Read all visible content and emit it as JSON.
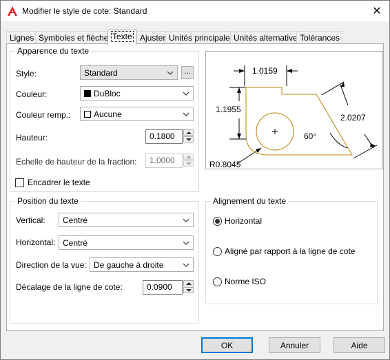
{
  "window": {
    "title": "Modifier le style de cote: Standard",
    "close_symbol": "✕"
  },
  "tabs": [
    {
      "label": "Lignes"
    },
    {
      "label": "Symboles et flèches"
    },
    {
      "label": "Texte",
      "active": true
    },
    {
      "label": "Ajuster"
    },
    {
      "label": "Unités principales"
    },
    {
      "label": "Unités alternatives"
    },
    {
      "label": "Tolérances"
    }
  ],
  "appearance": {
    "legend": "Apparence du texte",
    "style_label": "Style:",
    "style_value": "Standard",
    "browse_label": "...",
    "color_label": "Couleur:",
    "color_value": "DuBloc",
    "color_swatch": "#000000",
    "fill_label": "Couleur remp.:",
    "fill_value": "Aucune",
    "fill_swatch": "#ffffff",
    "height_label": "Hauteur:",
    "height_value": "0.1800",
    "fraction_label": "Echelle de hauteur de la fraction:",
    "fraction_value": "1.0000",
    "frame_label": "Encadrer le texte",
    "frame_checked": false
  },
  "position": {
    "legend": "Position du texte",
    "vertical_label": "Vertical:",
    "vertical_value": "Centré",
    "horizontal_label": "Horizontal:",
    "horizontal_value": "Centré",
    "view_label": "Direction de la vue:",
    "view_value": "De gauche à droite",
    "offset_label": "Décalage de la ligne de cote:",
    "offset_value": "0.0900"
  },
  "alignment": {
    "legend": "Alignement du texte",
    "options": [
      {
        "label": "Horizontal",
        "checked": true
      },
      {
        "label": "Aligné par rapport à la ligne de cote",
        "checked": false
      },
      {
        "label": "Norme ISO",
        "checked": false
      }
    ]
  },
  "preview": {
    "dim_top": "1.0159",
    "dim_left": "1.1955",
    "dim_right": "2.0207",
    "dim_angle": "60°",
    "dim_radius": "R0.8045",
    "outline_color": "#b8860b"
  },
  "buttons": {
    "ok": "OK",
    "cancel": "Annuler",
    "help": "Aide"
  }
}
